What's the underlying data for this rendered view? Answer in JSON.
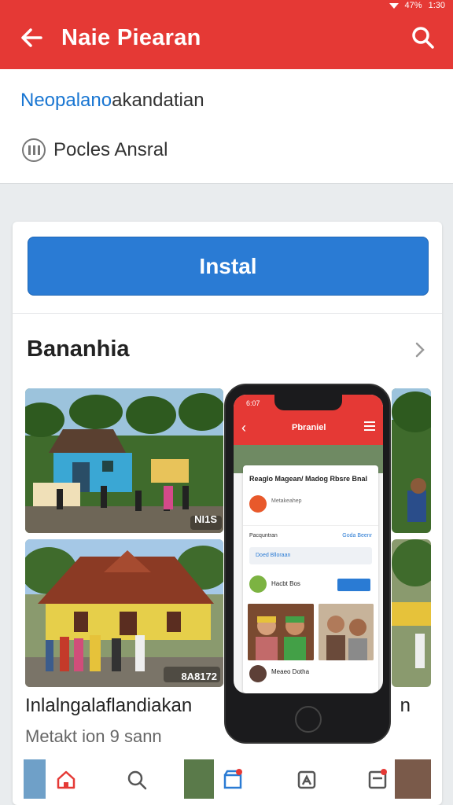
{
  "status": {
    "battery": "47%",
    "time": "1:30"
  },
  "appbar": {
    "title": "Naie Piearan"
  },
  "info": {
    "link_blue": "Neopalano",
    "link_rest": "akandatian",
    "row_label": "Pocles Ansral"
  },
  "main": {
    "install_label": "Instal",
    "section_title": "Bananhia",
    "photo1_tag": "NI1S",
    "photo2_tag": "8A8172",
    "caption": "Inlalngalaflandiakan",
    "caption_suffix": "n",
    "subcaption": "Metakt ion 9 sann"
  },
  "phone": {
    "time": "6:07",
    "title": "Pbraniel",
    "heading": "Reaglo Magean/ Madog Rbsre Bnal",
    "subtitle": "Metakeahep",
    "label_left": "Pacquntran",
    "label_right": "Goda Beenr",
    "input_text": "Doed Blloraan",
    "name": "Hacbt Bos",
    "footer": "Meaeo Dotha"
  },
  "colors": {
    "primary": "#e53935",
    "accent": "#2a7bd4"
  },
  "icons": [
    "back-arrow-icon",
    "search-icon",
    "info-icon",
    "chevron-right-icon",
    "home-icon",
    "store-icon",
    "tools-icon",
    "profile-icon"
  ]
}
